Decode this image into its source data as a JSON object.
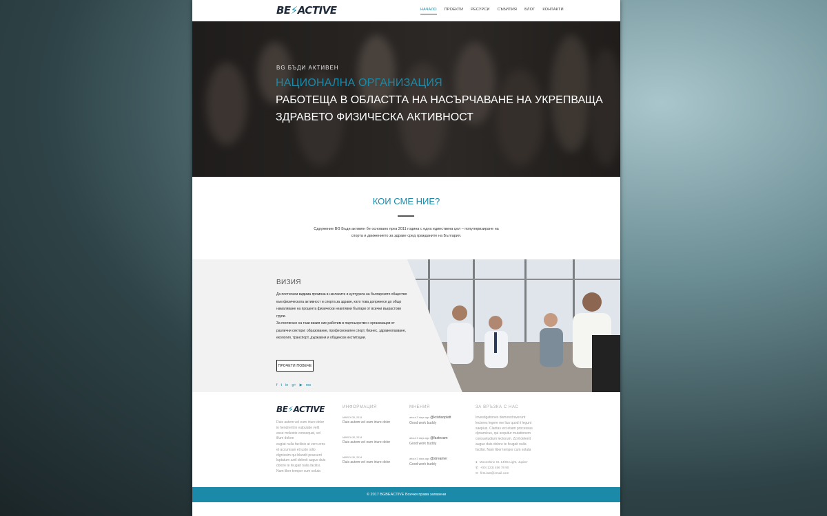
{
  "header": {
    "logo_part1": "BE",
    "logo_mark": "⚡",
    "logo_part2": "ACTIVE",
    "nav": [
      "НАЧАЛО",
      "ПРОЕКТИ",
      "РЕСУРСИ",
      "СЪБИТИЯ",
      "БЛОГ",
      "КОНТАКТИ"
    ]
  },
  "hero": {
    "eyebrow": "BG БЪДИ АКТИВЕН",
    "line1": "НАЦИОНАЛНА ОРГАНИЗАЦИЯ",
    "line2": "РАБОТЕЩА В ОБЛАСТТА НА НАСЪРЧАВАНЕ НА УКРЕПВАЩА",
    "line3": "ЗДРАВЕТО ФИЗИЧЕСКА АКТИВНОСТ"
  },
  "who": {
    "title": "КОИ СМЕ НИЕ?",
    "text": "Сдружение BG Бъди активен бе основано през 2011 година с една единствена цел – популяризиране на спорта и движението за здраве сред гражданите на България."
  },
  "vision": {
    "title": "ВИЗИЯ",
    "p1": "Да постигнем видима промяна в нагласите и културата на българското общество към физическата активност и спорта за здраве, като това допринесе до общо намаляване на процента физически неактивни българи от всички възрастови групи.",
    "p2": "За постигане на тази визия ние работим в партньорство с организации от различни сектори: образование, професионален спорт, бизнес, здравеопазване, екология, транспорт, държавни и общински институции.",
    "button": "ПРОЧЕТИ ПОВЕЧЕ",
    "socials": [
      "f",
      "t",
      "in",
      "g+",
      "▶",
      "rss"
    ]
  },
  "footer": {
    "logo_part1": "BE",
    "logo_mark": "⚡",
    "logo_part2": "ACTIVE",
    "about1": "Duis autem vel eum iriure dolor in hendrerit in vulputate velit esse molestie consequat, vel illum dolore",
    "about2": "eugiat nulla facilisis at vero eros et accumsan et iusto odio dignissim qui blandit praesent luptatum zzril delenit augue duis dolore te feugait nulla facilisi. Nam liber tempor cum soluta",
    "info_title": "ИНФОРМАЦИЯ",
    "info": [
      {
        "date": "MARCH 30, 2014",
        "text": "Duis autem vel eum iriure dolor"
      },
      {
        "date": "MARCH 30, 2014",
        "text": "Duis autem vel eum iriure dolor"
      },
      {
        "date": "MARCH 30, 2014",
        "text": "Duis autem vel eum iriure dolor"
      }
    ],
    "opinions_title": "МНЕНИЯ",
    "opinions": [
      {
        "meta": "about 3 days ago",
        "user": "@kristianplatt",
        "text": "Good work buddy"
      },
      {
        "meta": "about 3 days ago",
        "user": "@fastexam",
        "text": "Good work buddy"
      },
      {
        "meta": "about 3 days ago",
        "user": "@streamer",
        "text": "Good work buddy"
      }
    ],
    "contact_title": "ЗА ВРЪЗКА С НАС",
    "contact_text": "Investigationes demonstraverunt lectores legere me lius quod ii legunt saepius. Claritas est etiam processus dynamicus, qui sequitur mutationem consuetudium lectorum. Zzril delenit augue duis dolore te feugait nulla facilisi. Nam liber tempor cum soluta",
    "address": "Moonshine St. 14/05 Light, Jupiter",
    "phone": "+00 (123) 456 78 90",
    "email": "first.last@email.com"
  },
  "copyright": "© 2017 BGBEACTIVE Всички права запазени"
}
